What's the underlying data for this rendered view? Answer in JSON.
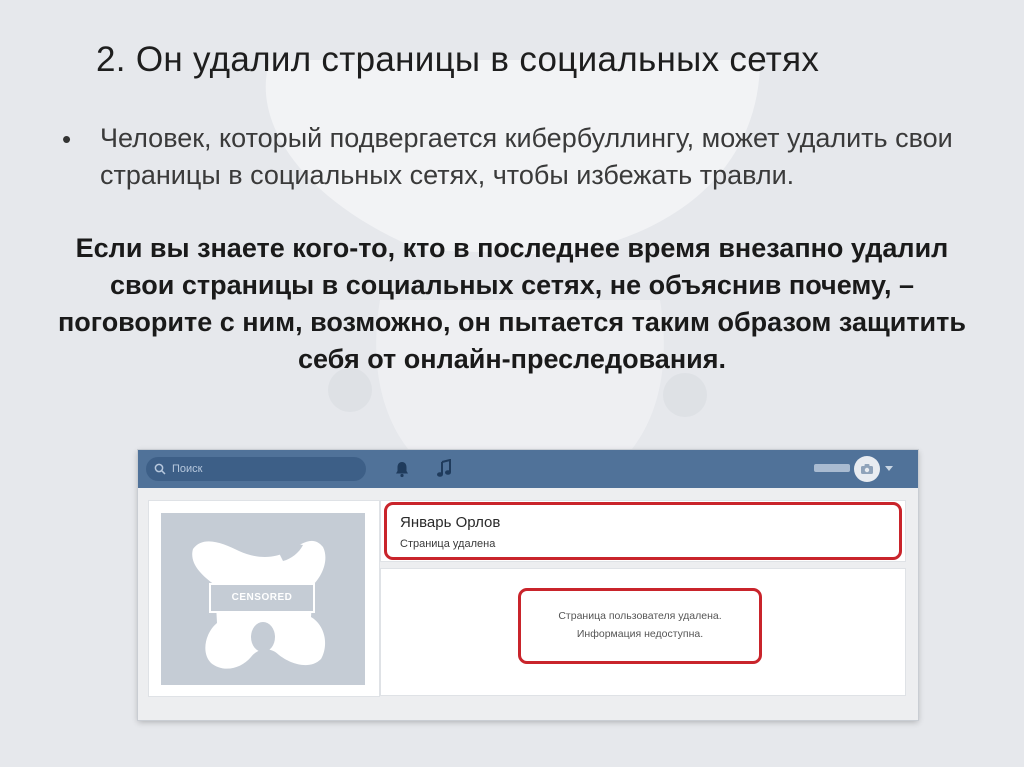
{
  "slide": {
    "title": "2. Он удалил страницы в социальных сетях",
    "bullet": "Человек, который подвергается кибербуллингу, может удалить свои страницы в социальных сетях, чтобы избежать травли.",
    "emphasis": "Если вы знаете кого-то, кто в последнее время внезапно удалил свои страницы в социальных сетях, не объяснив почему, – поговорите с ним, возможно, он пытается таким образом защитить себя от онлайн-преследования."
  },
  "screenshot": {
    "search_placeholder": "Поиск",
    "photo_overlay_label": "CENSORED",
    "profile_name": "Январь Орлов",
    "profile_status": "Страница удалена",
    "info_line1": "Страница пользователя удалена.",
    "info_line2": "Информация недоступна.",
    "icons": [
      "search-icon",
      "bell-icon",
      "music-note-icon",
      "camera-icon",
      "chevron-down-icon"
    ],
    "colors": {
      "header": "#507299",
      "highlight": "#c9242b",
      "page_bg": "#edeef0"
    }
  }
}
